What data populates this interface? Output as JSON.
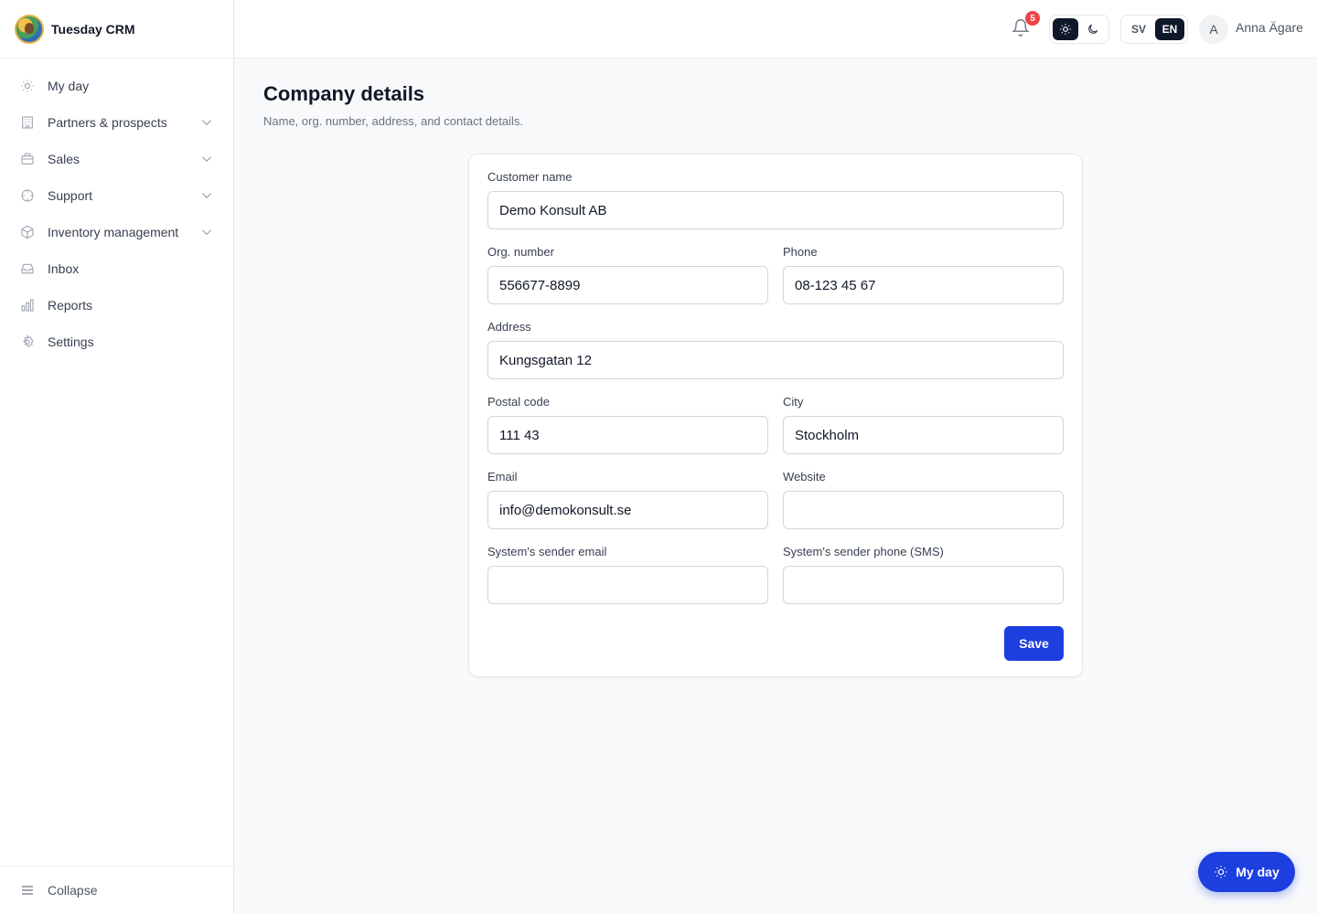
{
  "app": {
    "name": "Tuesday CRM"
  },
  "sidebar": {
    "items": [
      {
        "label": "My day",
        "icon": "sun-icon",
        "expandable": false
      },
      {
        "label": "Partners & prospects",
        "icon": "building-icon",
        "expandable": true
      },
      {
        "label": "Sales",
        "icon": "briefcase-icon",
        "expandable": true
      },
      {
        "label": "Support",
        "icon": "lifebuoy-icon",
        "expandable": true
      },
      {
        "label": "Inventory management",
        "icon": "box-icon",
        "expandable": true
      },
      {
        "label": "Inbox",
        "icon": "inbox-icon",
        "expandable": false
      },
      {
        "label": "Reports",
        "icon": "bar-chart-icon",
        "expandable": false
      },
      {
        "label": "Settings",
        "icon": "gear-icon",
        "expandable": false
      }
    ],
    "collapse_label": "Collapse"
  },
  "header": {
    "notification_count": "5",
    "theme": {
      "active": "light"
    },
    "lang": {
      "sv": "SV",
      "en": "EN",
      "active": "EN"
    },
    "user": {
      "initial": "A",
      "name": "Anna Ägare"
    }
  },
  "page": {
    "title": "Company details",
    "subtitle": "Name, org. number, address, and contact details."
  },
  "form": {
    "customer_name": {
      "label": "Customer name",
      "value": "Demo Konsult AB"
    },
    "org_number": {
      "label": "Org. number",
      "value": "556677-8899"
    },
    "phone": {
      "label": "Phone",
      "value": "08-123 45 67"
    },
    "address": {
      "label": "Address",
      "value": "Kungsgatan 12"
    },
    "postal_code": {
      "label": "Postal code",
      "value": "111 43"
    },
    "city": {
      "label": "City",
      "value": "Stockholm"
    },
    "email": {
      "label": "Email",
      "value": "info@demokonsult.se"
    },
    "website": {
      "label": "Website",
      "value": ""
    },
    "sender_email": {
      "label": "System's sender email",
      "value": ""
    },
    "sender_phone": {
      "label": "System's sender phone (SMS)",
      "value": ""
    },
    "save_label": "Save"
  },
  "fab": {
    "label": "My day"
  },
  "colors": {
    "primary": "#1d3fe0",
    "badge": "#ef4444",
    "dark": "#0f172a"
  }
}
